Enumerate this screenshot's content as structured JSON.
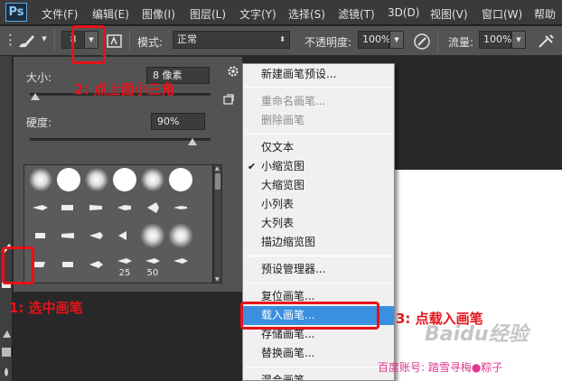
{
  "app": {
    "logo": "Ps"
  },
  "menubar": {
    "items": [
      "文件(F)",
      "编辑(E)",
      "图像(I)",
      "图层(L)",
      "文字(Y)",
      "选择(S)",
      "滤镜(T)",
      "3D(D)",
      "视图(V)",
      "窗口(W)",
      "帮助"
    ]
  },
  "optbar": {
    "brush_size": "8",
    "mode_label": "模式:",
    "mode_value": "正常",
    "opacity_label": "不透明度:",
    "opacity_value": "100%",
    "flow_label": "流量:",
    "flow_value": "100%"
  },
  "brush_panel": {
    "size_label": "大小:",
    "size_value": "8 像素",
    "hardness_label": "硬度:",
    "hardness_value": "90%",
    "size_fraction": 0.03,
    "hardness_fraction": 0.9,
    "brush_numbers": [
      "25",
      "50"
    ]
  },
  "context_menu": {
    "items": [
      {
        "label": "新建画笔预设...",
        "disabled": false,
        "checked": false,
        "highlighted": false
      },
      {
        "label": "重命名画笔...",
        "disabled": true,
        "checked": false,
        "highlighted": false
      },
      {
        "label": "删除画笔",
        "disabled": true,
        "checked": false,
        "highlighted": false
      },
      {
        "label": "仅文本",
        "disabled": false,
        "checked": false,
        "highlighted": false
      },
      {
        "label": "小缩览图",
        "disabled": false,
        "checked": true,
        "highlighted": false
      },
      {
        "label": "大缩览图",
        "disabled": false,
        "checked": false,
        "highlighted": false
      },
      {
        "label": "小列表",
        "disabled": false,
        "checked": false,
        "highlighted": false
      },
      {
        "label": "大列表",
        "disabled": false,
        "checked": false,
        "highlighted": false
      },
      {
        "label": "描边缩览图",
        "disabled": false,
        "checked": false,
        "highlighted": false
      },
      {
        "label": "预设管理器...",
        "disabled": false,
        "checked": false,
        "highlighted": false
      },
      {
        "label": "复位画笔...",
        "disabled": false,
        "checked": false,
        "highlighted": false
      },
      {
        "label": "载入画笔...",
        "disabled": false,
        "checked": false,
        "highlighted": true
      },
      {
        "label": "存储画笔...",
        "disabled": false,
        "checked": false,
        "highlighted": false
      },
      {
        "label": "替换画笔...",
        "disabled": false,
        "checked": false,
        "highlighted": false
      },
      {
        "label": "混合画笔",
        "disabled": false,
        "checked": false,
        "highlighted": false
      }
    ],
    "check_glyph": "✔"
  },
  "annotations": {
    "step1": "1: 选中画笔",
    "step2": "2: 点上面小三角",
    "step3": "3: 点载入画笔",
    "color": "#e8121a"
  },
  "watermark": "Baidu经验",
  "credit": "百度账号: 踏雪寻梅●粽子",
  "icons": {
    "gear": "gear-icon",
    "new_preset": "new-preset-icon",
    "brush_tool": "brush-icon",
    "airbrush": "airbrush-icon",
    "pressure": "pressure-icon"
  }
}
